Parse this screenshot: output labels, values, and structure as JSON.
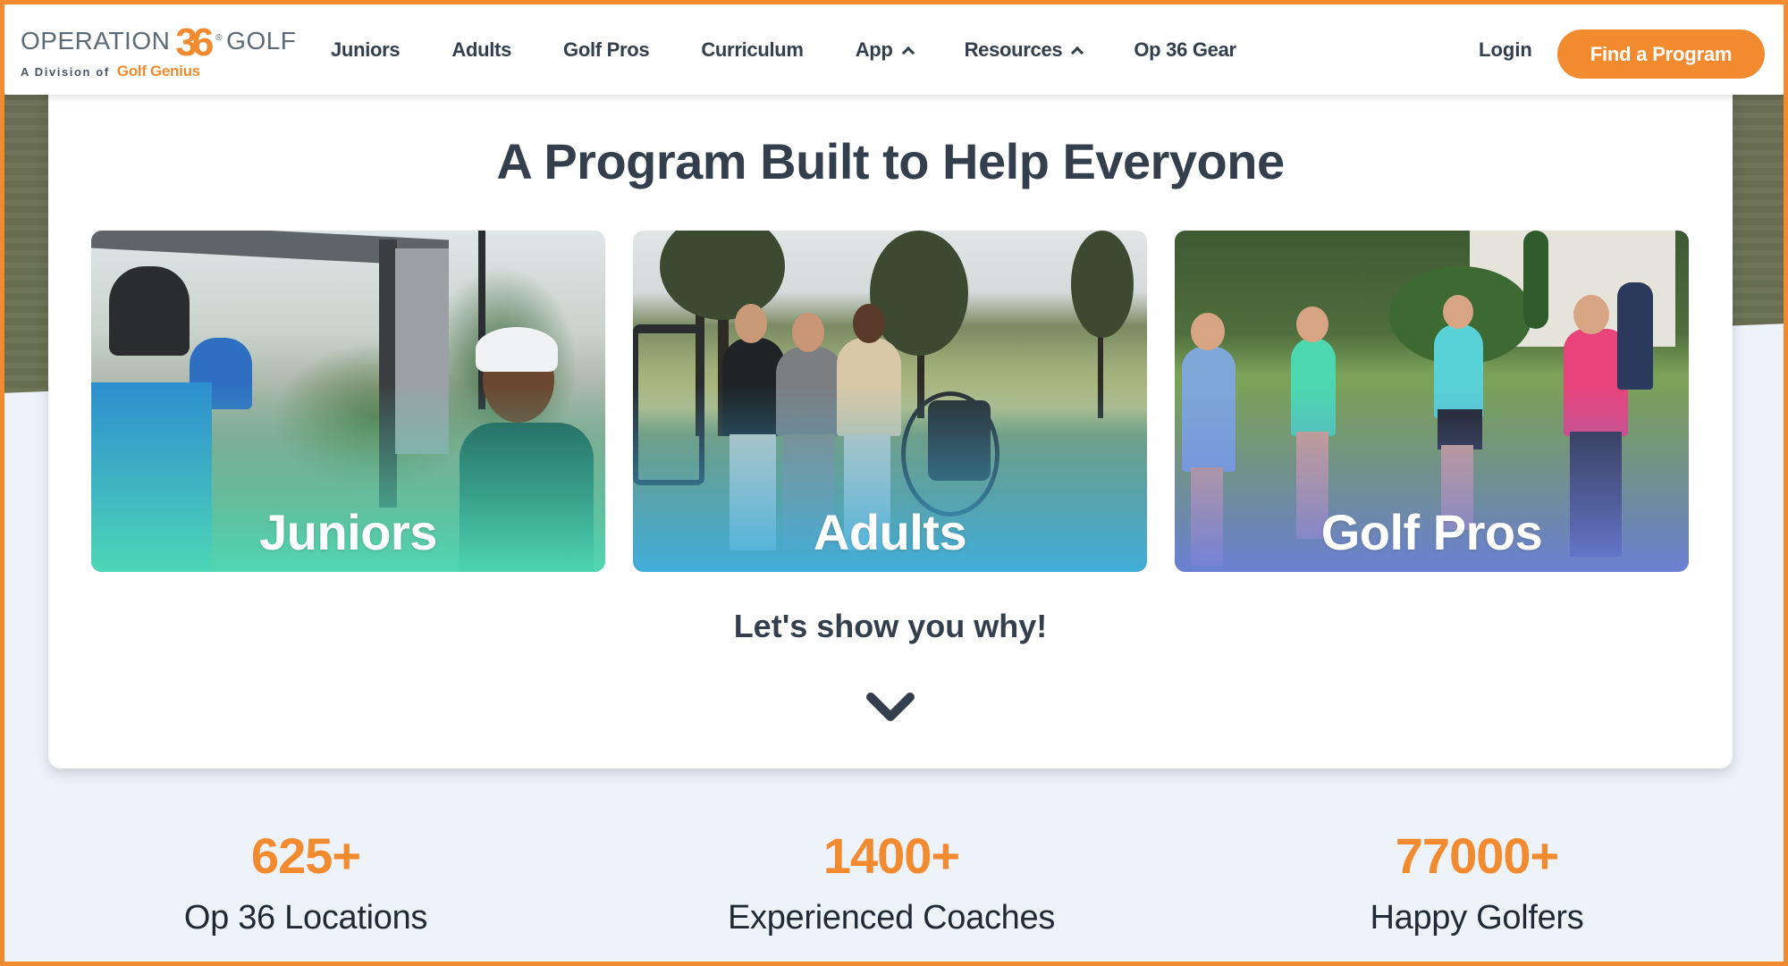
{
  "brand": {
    "logo_text_left": "OPERATION",
    "logo_number": "36",
    "logo_registered": "®",
    "logo_text_right": "GOLF",
    "tagline_prefix": "A Division of",
    "tagline_brand": "Golf Genius",
    "accent_color": "#f28a30",
    "text_color": "#333f4d"
  },
  "nav": {
    "items": [
      {
        "label": "Juniors",
        "has_dropdown": false
      },
      {
        "label": "Adults",
        "has_dropdown": false
      },
      {
        "label": "Golf Pros",
        "has_dropdown": false
      },
      {
        "label": "Curriculum",
        "has_dropdown": false
      },
      {
        "label": "App",
        "has_dropdown": true,
        "icon": "chevron-up-icon"
      },
      {
        "label": "Resources",
        "has_dropdown": true,
        "icon": "chevron-up-icon"
      },
      {
        "label": "Op 36 Gear",
        "has_dropdown": false
      }
    ],
    "login_label": "Login",
    "cta_label": "Find a Program"
  },
  "main": {
    "title": "A Program Built to Help Everyone",
    "cards": [
      {
        "label": "Juniors",
        "overlay_color": "#4fdbb5",
        "image": "junior golfer smiling beside golf cart with clubs"
      },
      {
        "label": "Adults",
        "overlay_color": "#3fb0e0",
        "image": "three adult men talking on golf course with push carts"
      },
      {
        "label": "Golf Pros",
        "overlay_color": "#6b7fdc",
        "image": "golf pro instructing women on putting green"
      }
    ],
    "subtitle": "Let's show you why!",
    "scroll_icon": "chevron-down-icon"
  },
  "stats": [
    {
      "value": "625+",
      "label": "Op 36 Locations"
    },
    {
      "value": "1400+",
      "label": "Experienced Coaches"
    },
    {
      "value": "77000+",
      "label": "Happy Golfers"
    }
  ]
}
